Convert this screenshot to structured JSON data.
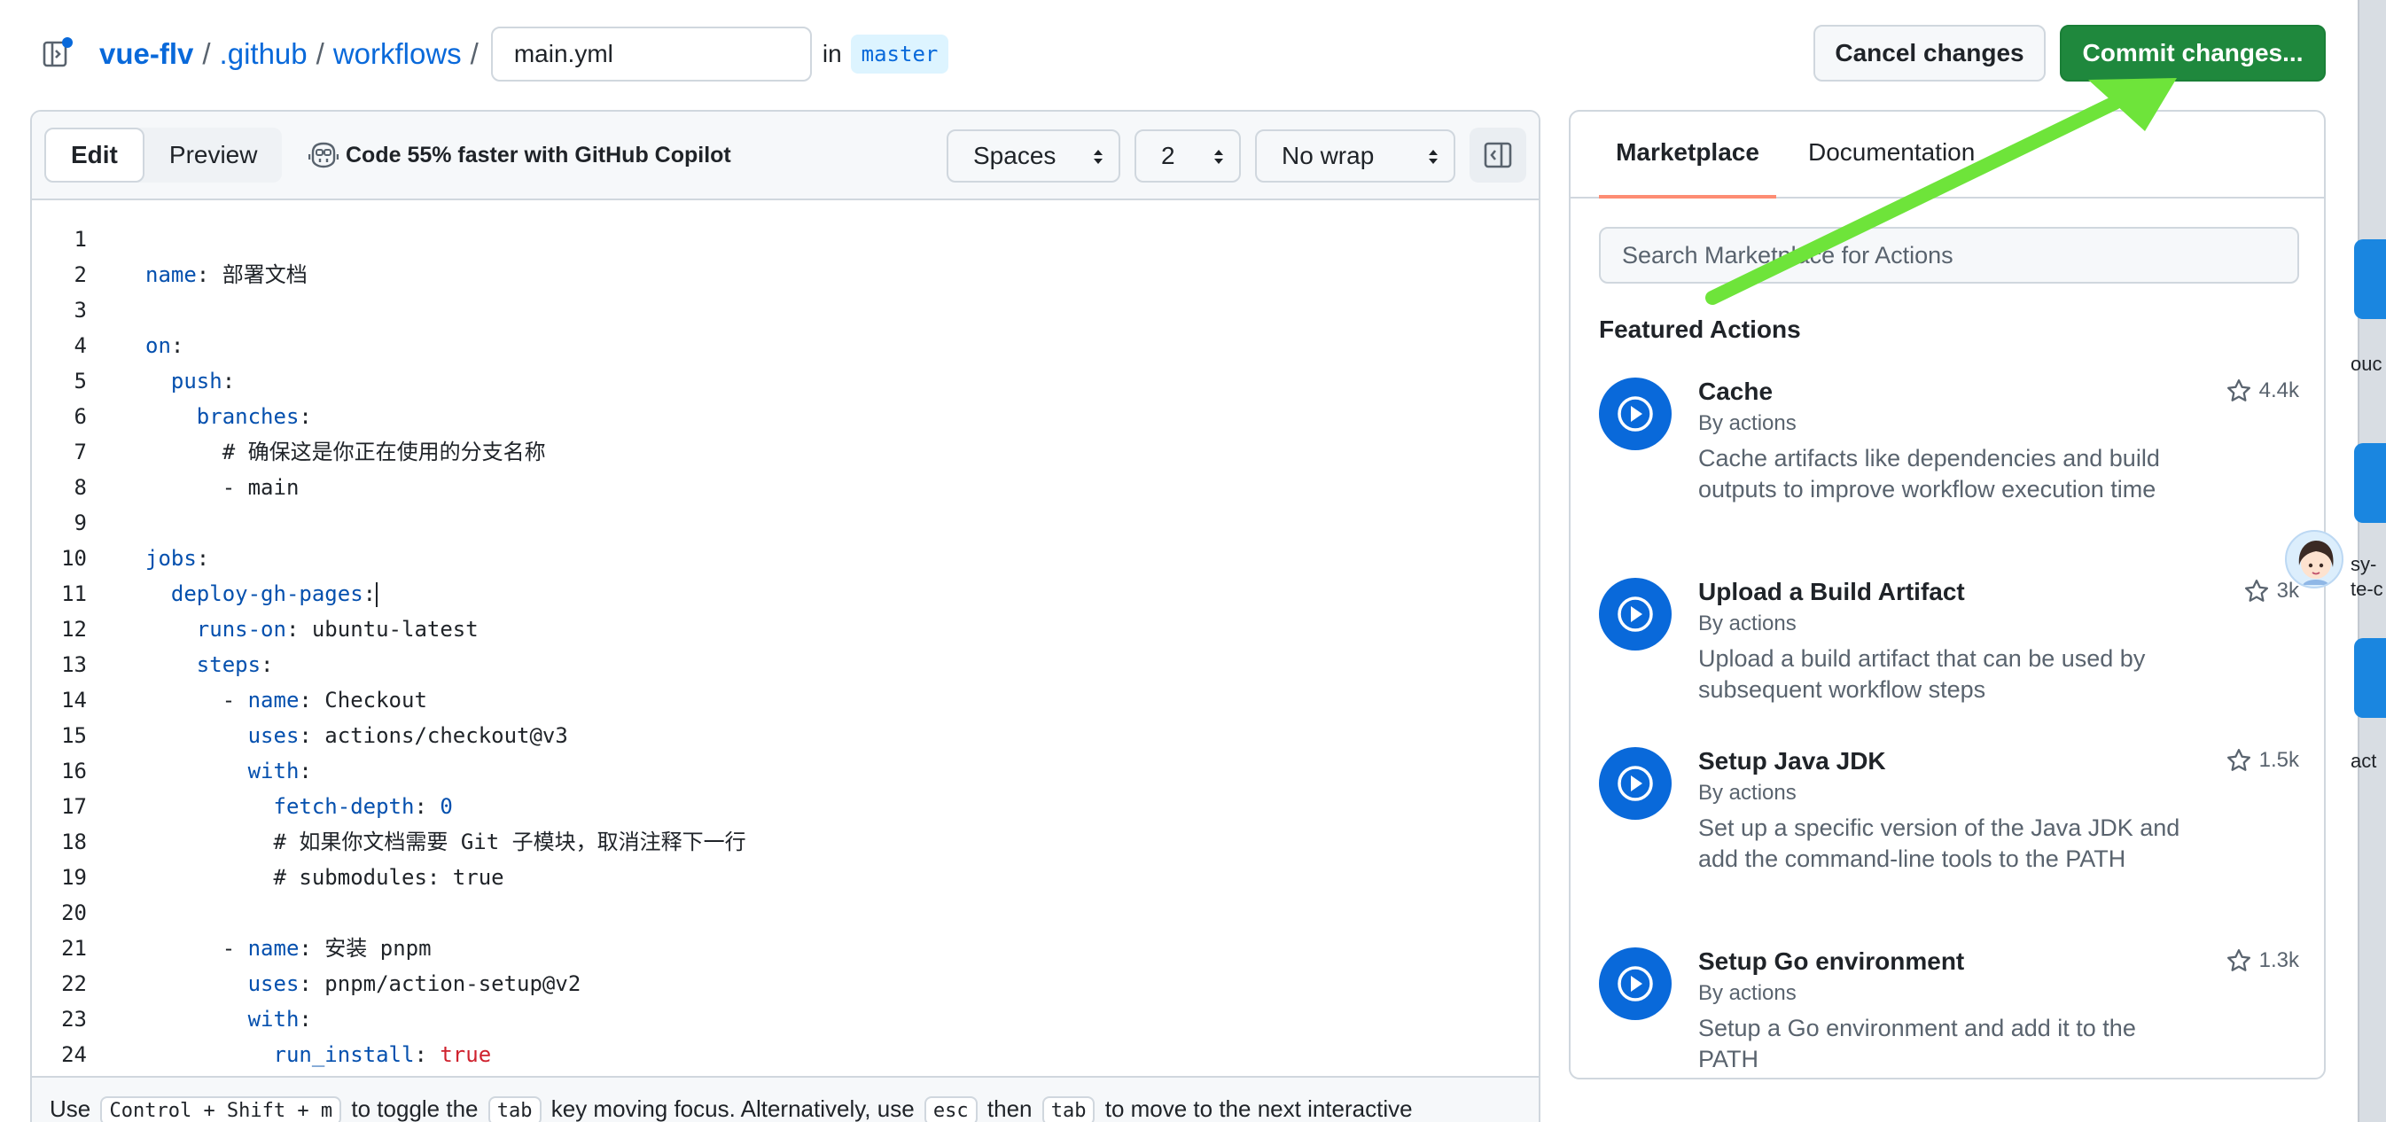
{
  "header": {
    "breadcrumb": {
      "repo": "vue-flv",
      "dir1": ".github",
      "dir2": "workflows",
      "sep": "/"
    },
    "filename": "main.yml",
    "in_label": "in",
    "branch": "master",
    "cancel_label": "Cancel changes",
    "commit_label": "Commit changes..."
  },
  "editor": {
    "tabs": {
      "edit": "Edit",
      "preview": "Preview"
    },
    "copilot_label": "Code 55% faster with GitHub Copilot",
    "indent_mode": "Spaces",
    "indent_size": "2",
    "wrap_mode": "No wrap",
    "lines": [
      {
        "n": "1",
        "indent": "",
        "key": "",
        "sep": "",
        "val": ""
      },
      {
        "n": "2",
        "indent": "",
        "key": "name",
        "sep": ": ",
        "val": "部署文档"
      },
      {
        "n": "3",
        "indent": "",
        "key": "",
        "sep": "",
        "val": ""
      },
      {
        "n": "4",
        "indent": "",
        "key": "on",
        "sep": ":",
        "val": ""
      },
      {
        "n": "5",
        "indent": "  ",
        "key": "push",
        "sep": ":",
        "val": ""
      },
      {
        "n": "6",
        "indent": "    ",
        "key": "branches",
        "sep": ":",
        "val": ""
      },
      {
        "n": "7",
        "indent": "      ",
        "key": "",
        "sep": "",
        "val": "# 确保这是你正在使用的分支名称"
      },
      {
        "n": "8",
        "indent": "      ",
        "key": "",
        "sep": "",
        "val": "- main"
      },
      {
        "n": "9",
        "indent": "",
        "key": "",
        "sep": "",
        "val": ""
      },
      {
        "n": "10",
        "indent": "",
        "key": "jobs",
        "sep": ":",
        "val": ""
      },
      {
        "n": "11",
        "indent": "  ",
        "key": "deploy-gh-pages",
        "sep": ":",
        "val": ""
      },
      {
        "n": "12",
        "indent": "    ",
        "key": "runs-on",
        "sep": ": ",
        "val": "ubuntu-latest"
      },
      {
        "n": "13",
        "indent": "    ",
        "key": "steps",
        "sep": ":",
        "val": ""
      },
      {
        "n": "14",
        "indent": "      - ",
        "key": "name",
        "sep": ": ",
        "val": "Checkout"
      },
      {
        "n": "15",
        "indent": "        ",
        "key": "uses",
        "sep": ": ",
        "val": "actions/checkout@v3"
      },
      {
        "n": "16",
        "indent": "        ",
        "key": "with",
        "sep": ":",
        "val": ""
      },
      {
        "n": "17",
        "indent": "          ",
        "key": "fetch-depth",
        "sep": ": ",
        "val": "0"
      },
      {
        "n": "18",
        "indent": "          ",
        "key": "",
        "sep": "",
        "val": "# 如果你文档需要 Git 子模块，取消注释下一行"
      },
      {
        "n": "19",
        "indent": "          ",
        "key": "",
        "sep": "",
        "val": "# submodules: true"
      },
      {
        "n": "20",
        "indent": "",
        "key": "",
        "sep": "",
        "val": ""
      },
      {
        "n": "21",
        "indent": "      - ",
        "key": "name",
        "sep": ": ",
        "val": "安装 pnpm"
      },
      {
        "n": "22",
        "indent": "        ",
        "key": "uses",
        "sep": ": ",
        "val": "pnpm/action-setup@v2"
      },
      {
        "n": "23",
        "indent": "        ",
        "key": "with",
        "sep": ":",
        "val": ""
      },
      {
        "n": "24",
        "indent": "          ",
        "key": "run_install",
        "sep": ": ",
        "val": "true"
      }
    ],
    "footer": {
      "t1": "Use",
      "k1": "Control + Shift + m",
      "t2": "to toggle the",
      "k2": "tab",
      "t3": "key moving focus. Alternatively, use",
      "k3": "esc",
      "t4": "then",
      "k4": "tab",
      "t5": "to move to the next interactive"
    }
  },
  "marketplace": {
    "tab_marketplace": "Marketplace",
    "tab_docs": "Documentation",
    "search_placeholder": "Search Marketplace for Actions",
    "featured_title": "Featured Actions",
    "actions": [
      {
        "name": "Cache",
        "by": "By actions",
        "desc": "Cache artifacts like dependencies and build outputs to improve workflow execution time",
        "stars": "4.4k"
      },
      {
        "name": "Upload a Build Artifact",
        "by": "By actions",
        "desc": "Upload a build artifact that can be used by subsequent workflow steps",
        "stars": "3k"
      },
      {
        "name": "Setup Java JDK",
        "by": "By actions",
        "desc": "Set up a specific version of the Java JDK and add the command-line tools to the PATH",
        "stars": "1.5k"
      },
      {
        "name": "Setup Go environment",
        "by": "By actions",
        "desc": "Setup a Go environment and add it to the PATH",
        "stars": "1.3k"
      }
    ]
  },
  "edge": {
    "t1": "ouc",
    "t2": "sy-",
    "t3": "te-c",
    "t4": "act"
  },
  "colors": {
    "link": "#0969da",
    "commit_green": "#1f883d",
    "annotation_arrow": "#6ee43a",
    "tab_underline": "#fd8c73",
    "yaml_key": "#0550ae",
    "yaml_bool": "#cf222e"
  },
  "icons": {
    "file_tree": "sidebar-expand-icon",
    "copilot": "copilot-icon",
    "panel": "sidebar-collapse-icon",
    "action": "play-icon",
    "star": "star-icon"
  }
}
